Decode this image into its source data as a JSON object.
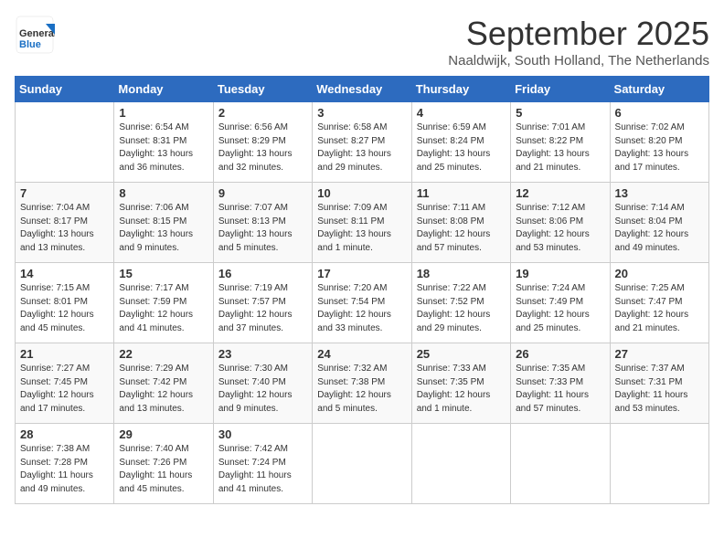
{
  "header": {
    "logo_general": "General",
    "logo_blue": "Blue",
    "month": "September 2025",
    "location": "Naaldwijk, South Holland, The Netherlands"
  },
  "days_of_week": [
    "Sunday",
    "Monday",
    "Tuesday",
    "Wednesday",
    "Thursday",
    "Friday",
    "Saturday"
  ],
  "weeks": [
    [
      {
        "num": "",
        "sunrise": "",
        "sunset": "",
        "daylight": ""
      },
      {
        "num": "1",
        "sunrise": "Sunrise: 6:54 AM",
        "sunset": "Sunset: 8:31 PM",
        "daylight": "Daylight: 13 hours and 36 minutes."
      },
      {
        "num": "2",
        "sunrise": "Sunrise: 6:56 AM",
        "sunset": "Sunset: 8:29 PM",
        "daylight": "Daylight: 13 hours and 32 minutes."
      },
      {
        "num": "3",
        "sunrise": "Sunrise: 6:58 AM",
        "sunset": "Sunset: 8:27 PM",
        "daylight": "Daylight: 13 hours and 29 minutes."
      },
      {
        "num": "4",
        "sunrise": "Sunrise: 6:59 AM",
        "sunset": "Sunset: 8:24 PM",
        "daylight": "Daylight: 13 hours and 25 minutes."
      },
      {
        "num": "5",
        "sunrise": "Sunrise: 7:01 AM",
        "sunset": "Sunset: 8:22 PM",
        "daylight": "Daylight: 13 hours and 21 minutes."
      },
      {
        "num": "6",
        "sunrise": "Sunrise: 7:02 AM",
        "sunset": "Sunset: 8:20 PM",
        "daylight": "Daylight: 13 hours and 17 minutes."
      }
    ],
    [
      {
        "num": "7",
        "sunrise": "Sunrise: 7:04 AM",
        "sunset": "Sunset: 8:17 PM",
        "daylight": "Daylight: 13 hours and 13 minutes."
      },
      {
        "num": "8",
        "sunrise": "Sunrise: 7:06 AM",
        "sunset": "Sunset: 8:15 PM",
        "daylight": "Daylight: 13 hours and 9 minutes."
      },
      {
        "num": "9",
        "sunrise": "Sunrise: 7:07 AM",
        "sunset": "Sunset: 8:13 PM",
        "daylight": "Daylight: 13 hours and 5 minutes."
      },
      {
        "num": "10",
        "sunrise": "Sunrise: 7:09 AM",
        "sunset": "Sunset: 8:11 PM",
        "daylight": "Daylight: 13 hours and 1 minute."
      },
      {
        "num": "11",
        "sunrise": "Sunrise: 7:11 AM",
        "sunset": "Sunset: 8:08 PM",
        "daylight": "Daylight: 12 hours and 57 minutes."
      },
      {
        "num": "12",
        "sunrise": "Sunrise: 7:12 AM",
        "sunset": "Sunset: 8:06 PM",
        "daylight": "Daylight: 12 hours and 53 minutes."
      },
      {
        "num": "13",
        "sunrise": "Sunrise: 7:14 AM",
        "sunset": "Sunset: 8:04 PM",
        "daylight": "Daylight: 12 hours and 49 minutes."
      }
    ],
    [
      {
        "num": "14",
        "sunrise": "Sunrise: 7:15 AM",
        "sunset": "Sunset: 8:01 PM",
        "daylight": "Daylight: 12 hours and 45 minutes."
      },
      {
        "num": "15",
        "sunrise": "Sunrise: 7:17 AM",
        "sunset": "Sunset: 7:59 PM",
        "daylight": "Daylight: 12 hours and 41 minutes."
      },
      {
        "num": "16",
        "sunrise": "Sunrise: 7:19 AM",
        "sunset": "Sunset: 7:57 PM",
        "daylight": "Daylight: 12 hours and 37 minutes."
      },
      {
        "num": "17",
        "sunrise": "Sunrise: 7:20 AM",
        "sunset": "Sunset: 7:54 PM",
        "daylight": "Daylight: 12 hours and 33 minutes."
      },
      {
        "num": "18",
        "sunrise": "Sunrise: 7:22 AM",
        "sunset": "Sunset: 7:52 PM",
        "daylight": "Daylight: 12 hours and 29 minutes."
      },
      {
        "num": "19",
        "sunrise": "Sunrise: 7:24 AM",
        "sunset": "Sunset: 7:49 PM",
        "daylight": "Daylight: 12 hours and 25 minutes."
      },
      {
        "num": "20",
        "sunrise": "Sunrise: 7:25 AM",
        "sunset": "Sunset: 7:47 PM",
        "daylight": "Daylight: 12 hours and 21 minutes."
      }
    ],
    [
      {
        "num": "21",
        "sunrise": "Sunrise: 7:27 AM",
        "sunset": "Sunset: 7:45 PM",
        "daylight": "Daylight: 12 hours and 17 minutes."
      },
      {
        "num": "22",
        "sunrise": "Sunrise: 7:29 AM",
        "sunset": "Sunset: 7:42 PM",
        "daylight": "Daylight: 12 hours and 13 minutes."
      },
      {
        "num": "23",
        "sunrise": "Sunrise: 7:30 AM",
        "sunset": "Sunset: 7:40 PM",
        "daylight": "Daylight: 12 hours and 9 minutes."
      },
      {
        "num": "24",
        "sunrise": "Sunrise: 7:32 AM",
        "sunset": "Sunset: 7:38 PM",
        "daylight": "Daylight: 12 hours and 5 minutes."
      },
      {
        "num": "25",
        "sunrise": "Sunrise: 7:33 AM",
        "sunset": "Sunset: 7:35 PM",
        "daylight": "Daylight: 12 hours and 1 minute."
      },
      {
        "num": "26",
        "sunrise": "Sunrise: 7:35 AM",
        "sunset": "Sunset: 7:33 PM",
        "daylight": "Daylight: 11 hours and 57 minutes."
      },
      {
        "num": "27",
        "sunrise": "Sunrise: 7:37 AM",
        "sunset": "Sunset: 7:31 PM",
        "daylight": "Daylight: 11 hours and 53 minutes."
      }
    ],
    [
      {
        "num": "28",
        "sunrise": "Sunrise: 7:38 AM",
        "sunset": "Sunset: 7:28 PM",
        "daylight": "Daylight: 11 hours and 49 minutes."
      },
      {
        "num": "29",
        "sunrise": "Sunrise: 7:40 AM",
        "sunset": "Sunset: 7:26 PM",
        "daylight": "Daylight: 11 hours and 45 minutes."
      },
      {
        "num": "30",
        "sunrise": "Sunrise: 7:42 AM",
        "sunset": "Sunset: 7:24 PM",
        "daylight": "Daylight: 11 hours and 41 minutes."
      },
      {
        "num": "",
        "sunrise": "",
        "sunset": "",
        "daylight": ""
      },
      {
        "num": "",
        "sunrise": "",
        "sunset": "",
        "daylight": ""
      },
      {
        "num": "",
        "sunrise": "",
        "sunset": "",
        "daylight": ""
      },
      {
        "num": "",
        "sunrise": "",
        "sunset": "",
        "daylight": ""
      }
    ]
  ]
}
